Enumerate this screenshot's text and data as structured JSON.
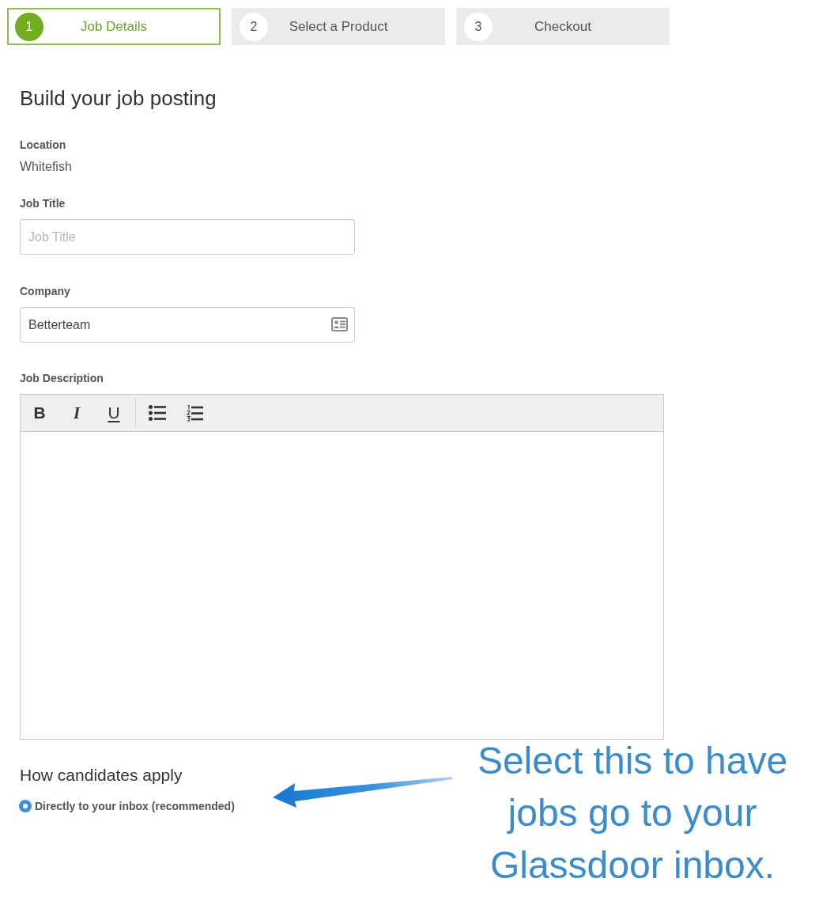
{
  "steps": [
    {
      "number": "1",
      "label": "Job Details",
      "selected": true
    },
    {
      "number": "2",
      "label": "Select a Product",
      "selected": false
    },
    {
      "number": "3",
      "label": "Checkout",
      "selected": false
    }
  ],
  "heading": "Build your job posting",
  "location": {
    "label": "Location",
    "value": "Whitefish"
  },
  "job_title": {
    "label": "Job Title",
    "placeholder": "Job Title"
  },
  "company": {
    "label": "Company",
    "value": "Betterteam"
  },
  "job_description": {
    "label": "Job Description",
    "toolbar": [
      {
        "kind": "bold",
        "text": "B"
      },
      {
        "kind": "italic",
        "text": "I"
      },
      {
        "kind": "underline",
        "text": "U"
      },
      {
        "kind": "bullet-list"
      },
      {
        "kind": "numbered-list"
      }
    ]
  },
  "apply": {
    "heading": "How candidates apply",
    "options": [
      {
        "label": "Directly to your inbox (recommended)",
        "selected": true
      }
    ]
  },
  "annotation": {
    "lines": [
      "Select this to have",
      "jobs go to your",
      "Glassdoor inbox."
    ]
  }
}
